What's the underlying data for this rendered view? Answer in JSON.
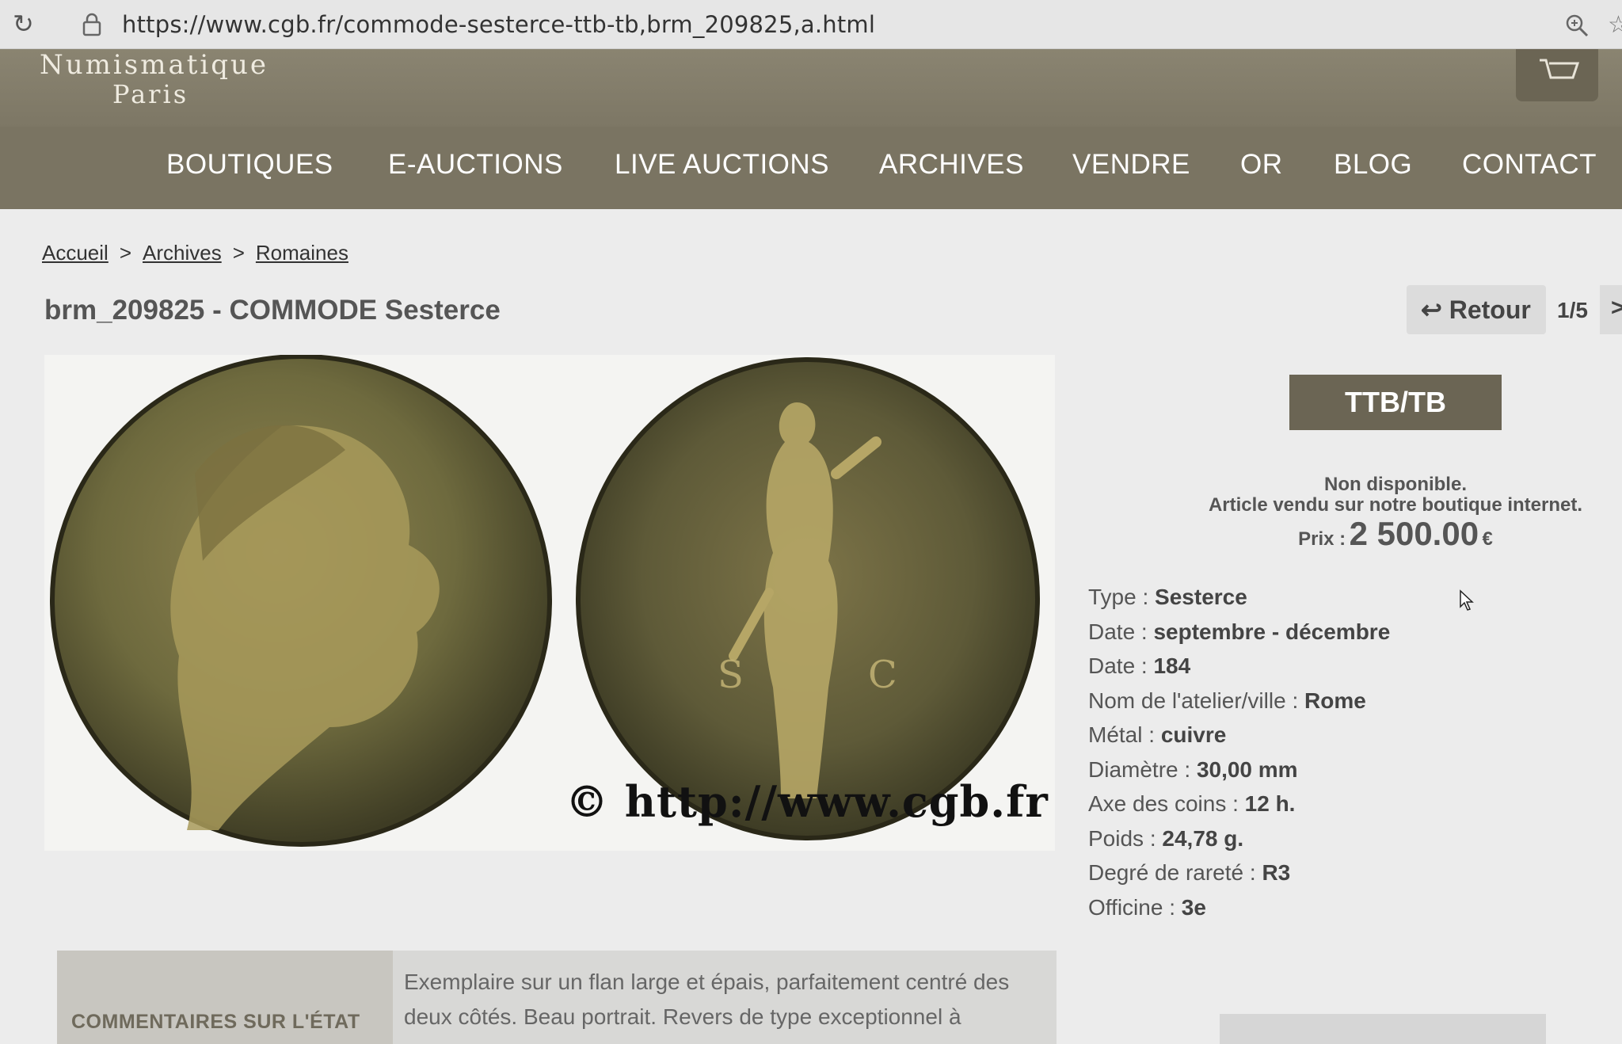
{
  "browser": {
    "url": "https://www.cgb.fr/commode-sesterce-ttb-tb,brm_209825,a.html"
  },
  "logo": {
    "line1": "Numismatique",
    "line2": "Paris"
  },
  "nav": {
    "items": [
      "BOUTIQUES",
      "E-AUCTIONS",
      "LIVE AUCTIONS",
      "ARCHIVES",
      "VENDRE",
      "OR",
      "BLOG",
      "CONTACT"
    ]
  },
  "breadcrumb": {
    "items": [
      "Accueil",
      "Archives",
      "Romaines"
    ],
    "separator": ">"
  },
  "product": {
    "title": "brm_209825 - COMMODE Sesterce",
    "grade": "TTB/TB",
    "availability_line1": "Non disponible.",
    "availability_line2": "Article vendu sur notre boutique internet.",
    "price_label": "Prix :",
    "price_value": "2 500.00",
    "price_currency": "€",
    "watermark": "© http://www.cgb.fr"
  },
  "pager": {
    "back_label": "↩ Retour",
    "count": "1/5",
    "next_label": ">"
  },
  "specs": [
    {
      "label": "Type : ",
      "value": "Sesterce"
    },
    {
      "label": "Date : ",
      "value": "septembre - décembre"
    },
    {
      "label": "Date : ",
      "value": "184"
    },
    {
      "label": "Nom de l'atelier/ville : ",
      "value": "Rome"
    },
    {
      "label": "Métal : ",
      "value": "cuivre"
    },
    {
      "label": "Diamètre : ",
      "value": "30,00 mm"
    },
    {
      "label": "Axe des coins : ",
      "value": "12 h."
    },
    {
      "label": "Poids : ",
      "value": "24,78 g."
    },
    {
      "label": "Degré de rareté : ",
      "value": "R3"
    },
    {
      "label": "Officine : ",
      "value": "3e"
    }
  ],
  "comments": {
    "label": "COMMENTAIRES SUR L'ÉTAT",
    "line1": "Exemplaire sur un flan large et épais, parfaitement centré des",
    "line2": "deux côtés. Beau portrait. Revers de type exceptionnel à"
  },
  "colors": {
    "header": "#7d7765",
    "nav": "#7a7462",
    "badge": "#6b6554"
  },
  "icons": {
    "reload": "reload-icon",
    "lock": "lock-icon",
    "zoom": "zoom-icon",
    "cart": "cart-icon"
  }
}
